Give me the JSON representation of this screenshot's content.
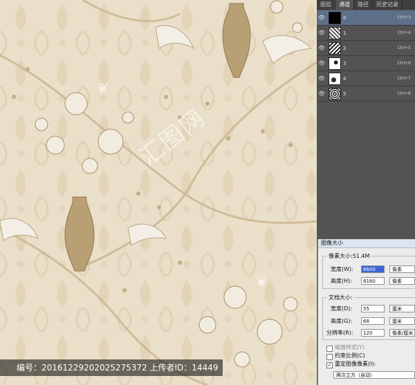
{
  "panel": {
    "tabs": [
      "图层",
      "通道",
      "路径",
      "历史记录"
    ],
    "layers": [
      {
        "name": "0",
        "shortcut": "Ctrl+3"
      },
      {
        "name": "1",
        "shortcut": "Ctrl+4"
      },
      {
        "name": "2",
        "shortcut": "Ctrl+5"
      },
      {
        "name": "3",
        "shortcut": "Ctrl+6"
      },
      {
        "name": "4",
        "shortcut": "Ctrl+7"
      },
      {
        "name": "5",
        "shortcut": "Ctrl+8"
      }
    ]
  },
  "dialog": {
    "title": "图像大小",
    "pixel_size": "像素大小:51.4M",
    "width_label": "宽度(W):",
    "width_value": "6600",
    "width_unit": "像素",
    "height_label": "高度(H):",
    "height_value": "8160",
    "height_unit": "像素",
    "doc_size_label": "文档大小:",
    "doc_width_label": "宽度(D):",
    "doc_width_value": "55",
    "doc_width_unit": "厘米",
    "doc_height_label": "高度(G):",
    "doc_height_value": "68",
    "doc_height_unit": "厘米",
    "resolution_label": "分辨率(R):",
    "resolution_value": "120",
    "resolution_unit": "像素/厘米",
    "scale_styles": "缩放样式(Y)",
    "constrain": "约束比例(C)",
    "resample": "重定图像像素(I):",
    "resample_method": "两次立方（自动）"
  },
  "watermark": {
    "info": "编号：20161229202025275372 上传者ID：14449",
    "logo": "汇图网"
  },
  "colors": {
    "paper": "#e9dcc4",
    "ink": "#b29a6a",
    "highlight": "#3b64d2"
  }
}
